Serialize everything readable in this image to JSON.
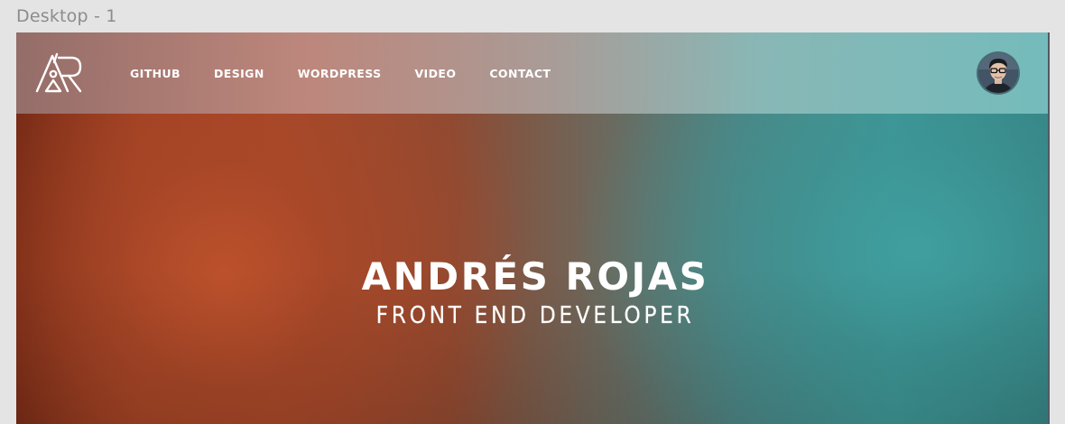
{
  "canvas": {
    "artboard_label": "Desktop - 1"
  },
  "header": {
    "logo_icon": "ar-monogram-logo",
    "nav": [
      {
        "label": "GITHUB"
      },
      {
        "label": "DESIGN"
      },
      {
        "label": "WORDPRESS"
      },
      {
        "label": "VIDEO"
      },
      {
        "label": "CONTACT"
      }
    ],
    "avatar_icon": "profile-avatar"
  },
  "hero": {
    "name": "ANDRÉS ROJAS",
    "role": "FRONT END DEVELOPER"
  },
  "colors": {
    "canvas_bg": "#e4e4e4",
    "hero_warm": "#a5472a",
    "hero_cool": "#3f9595",
    "text": "#ffffff"
  }
}
